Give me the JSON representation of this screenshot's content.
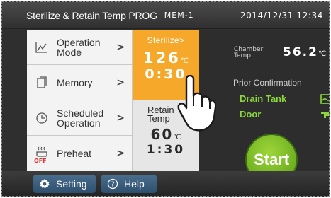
{
  "header": {
    "title": "Sterilize & Retain Temp PROG",
    "mem": "MEM-1",
    "datetime": "2014/12/31 12:34"
  },
  "menu": {
    "items": [
      {
        "label_line1": "Operation",
        "label_line2": "Mode",
        "icon": "mode-graph-icon"
      },
      {
        "label_line1": "Memory",
        "label_line2": "",
        "icon": "memory-doc-icon"
      },
      {
        "label_line1": "Scheduled",
        "label_line2": "Operation",
        "icon": "clock-icon"
      },
      {
        "label_line1": "Preheat",
        "label_line2": "",
        "icon": "preheat-icon",
        "tag": "OFF"
      }
    ],
    "chevron": ">"
  },
  "program": {
    "sterilize": {
      "label": "Sterilize",
      "chevron": ">",
      "temp": "126",
      "unit": "℃",
      "time": "0:30"
    },
    "retain": {
      "label_line1": "Retain",
      "label_line2": "Temp",
      "temp": "60",
      "unit": "℃",
      "time": "1:30"
    }
  },
  "status": {
    "chamber_line1": "Chamber",
    "chamber_line2": "Temp",
    "chamber_value": "56.2",
    "chamber_unit": "℃",
    "prior_title": "Prior Confirmation",
    "drain_tank": "Drain Tank",
    "door": "Door",
    "indicator_color": "#8bd83a"
  },
  "start_label": "Start",
  "footer": {
    "setting": "Setting",
    "help": "Help"
  },
  "colors": {
    "accent_orange": "#f5a82a",
    "start_green": "#6cae1e",
    "footer_blue": "#3b5f80"
  }
}
